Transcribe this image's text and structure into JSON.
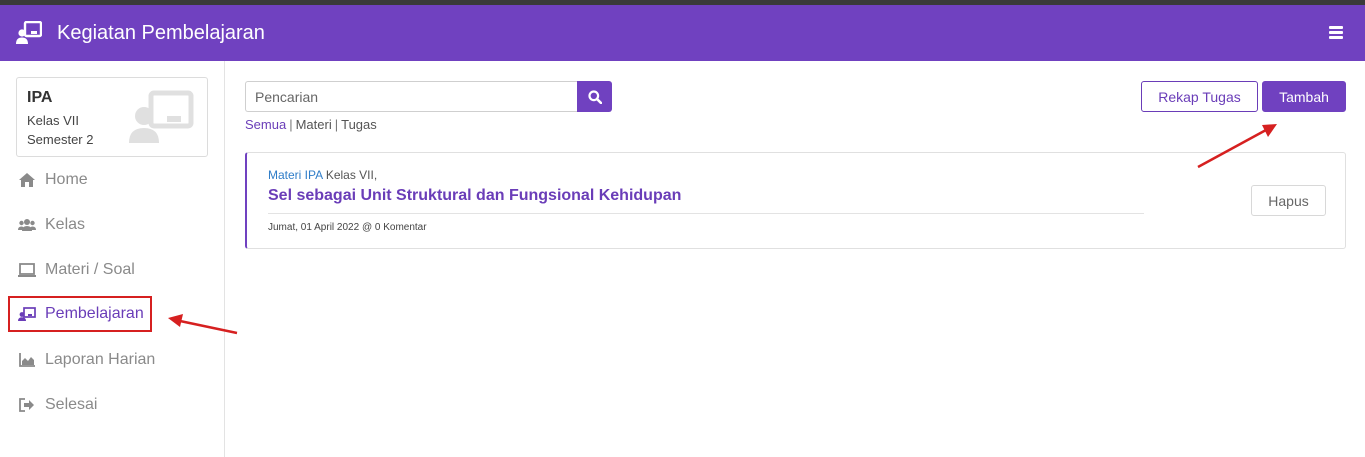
{
  "header": {
    "title": "Kegiatan Pembelajaran"
  },
  "profile": {
    "subject": "IPA",
    "class": "Kelas VII",
    "semester": "Semester 2"
  },
  "sidebar": {
    "items": [
      {
        "label": "Home",
        "icon": "home-icon"
      },
      {
        "label": "Kelas",
        "icon": "users-icon"
      },
      {
        "label": "Materi / Soal",
        "icon": "laptop-icon"
      },
      {
        "label": "Pembelajaran",
        "icon": "classroom-icon",
        "active": true
      },
      {
        "label": "Laporan Harian",
        "icon": "area-chart-icon"
      },
      {
        "label": "Selesai",
        "icon": "sign-out-icon"
      }
    ]
  },
  "search": {
    "placeholder": "Pencarian",
    "value": ""
  },
  "filters": {
    "all": "Semua",
    "material": "Materi",
    "task": "Tugas",
    "separator": "|"
  },
  "actions": {
    "rekap_label": "Rekap Tugas",
    "tambah_label": "Tambah"
  },
  "posts": [
    {
      "meta_link": "Materi IPA",
      "meta_rest": "Kelas VII,",
      "title": "Sel sebagai Unit Struktural dan Fungsional Kehidupan",
      "date": "Jumat, 01 April 2022 @ 0 Komentar",
      "delete_label": "Hapus"
    }
  ],
  "colors": {
    "primary": "#7041c0",
    "annotation": "#d62020",
    "link": "#2f7dc8"
  }
}
